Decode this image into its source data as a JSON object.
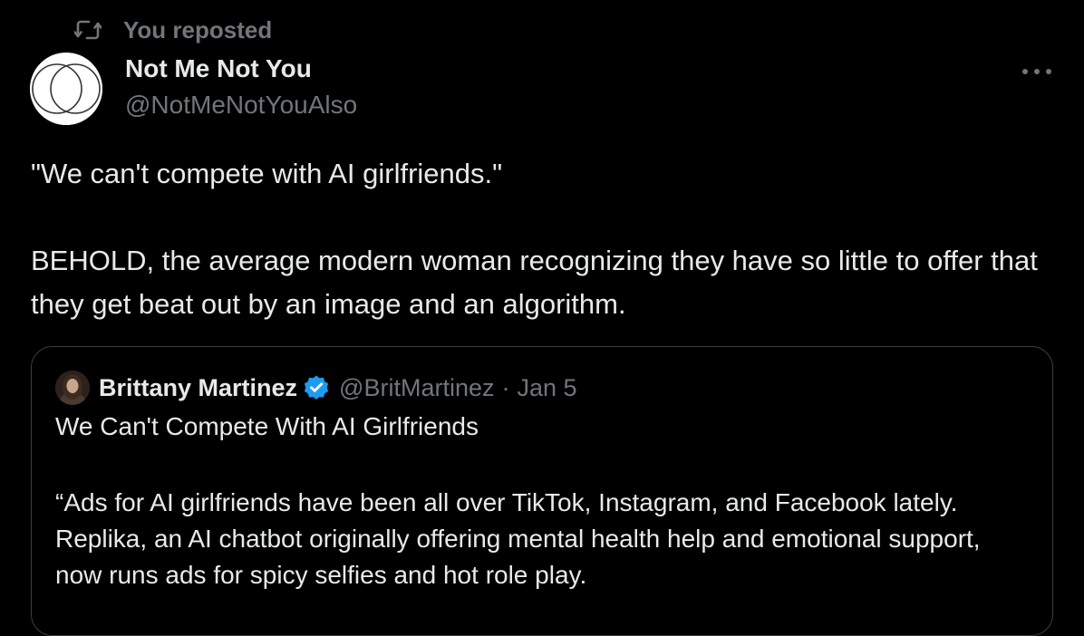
{
  "repost": {
    "label": "You reposted",
    "icon": "repost-icon"
  },
  "author": {
    "name": "Not Me Not You",
    "handle": "@NotMeNotYouAlso",
    "avatar_icon": "interlocking-circles-logo"
  },
  "more": {
    "icon": "more-options-icon",
    "glyph": "···"
  },
  "tweet": {
    "paragraph_1": "\"We can't compete with AI girlfriends.\"",
    "paragraph_2": "BEHOLD, the average modern woman recognizing they have so little to offer that they get beat out by an image and an algorithm."
  },
  "quote": {
    "name": "Brittany Martinez",
    "verified_icon": "verified-badge-icon",
    "handle": "@BritMartinez",
    "separator": "·",
    "date": "Jan 5",
    "title": "We Can't Compete With AI Girlfriends",
    "text": "“Ads for AI girlfriends have been all over TikTok, Instagram, and Facebook lately. Replika, an AI chatbot originally offering mental health help and emotional support, now runs ads for spicy selfies and hot role play."
  },
  "colors": {
    "background": "#000000",
    "text_primary": "#e7e9ea",
    "text_secondary": "#71767b",
    "border": "#3b3e42",
    "verified_blue": "#1d9bf0"
  }
}
